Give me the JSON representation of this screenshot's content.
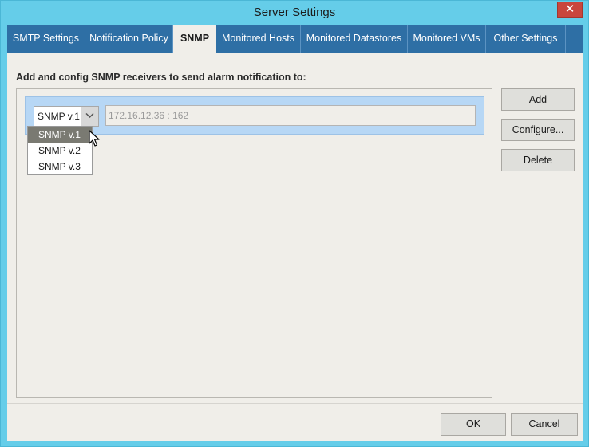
{
  "window": {
    "title": "Server Settings",
    "close_glyph": "✕"
  },
  "tabs": [
    {
      "label": "SMTP Settings"
    },
    {
      "label": "Notification Policy"
    },
    {
      "label": "SNMP"
    },
    {
      "label": "Monitored Hosts"
    },
    {
      "label": "Monitored Datastores"
    },
    {
      "label": "Monitored VMs"
    },
    {
      "label": "Other Settings"
    }
  ],
  "active_tab": "SNMP",
  "snmp": {
    "instruction": "Add and config SNMP receivers to send alarm notification to:",
    "receivers": [
      {
        "version": "SNMP v.1",
        "address": "172.16.12.36 : 162"
      }
    ],
    "version_options": [
      "SNMP v.1",
      "SNMP v.2",
      "SNMP v.3"
    ],
    "highlighted_option": "SNMP v.1"
  },
  "side_buttons": {
    "add": "Add",
    "configure": "Configure...",
    "delete": "Delete"
  },
  "footer": {
    "ok": "OK",
    "cancel": "Cancel"
  },
  "colors": {
    "window_frame": "#65cde9",
    "tab_bar": "#2e6fa5",
    "panel": "#f0eee9",
    "row_highlight": "#b7d7f5",
    "option_selected": "#7a7a72",
    "close_button": "#c9463d"
  }
}
